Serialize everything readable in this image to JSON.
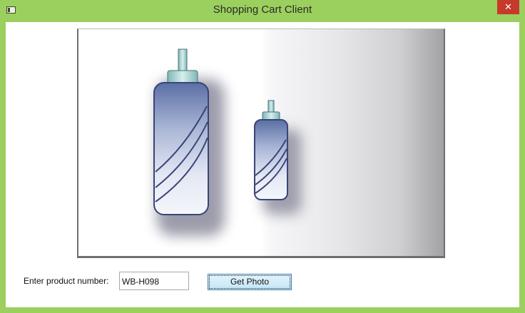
{
  "window": {
    "title": "Shopping Cart Client",
    "close_glyph": "✕",
    "frame_color": "#9bcf5e",
    "close_color": "#c7392b"
  },
  "photo": {
    "subject_icon": "water-bottle-image"
  },
  "form": {
    "prompt_label": "Enter product number:",
    "product_number_value": "WB-H098",
    "get_photo_label": "Get Photo"
  }
}
